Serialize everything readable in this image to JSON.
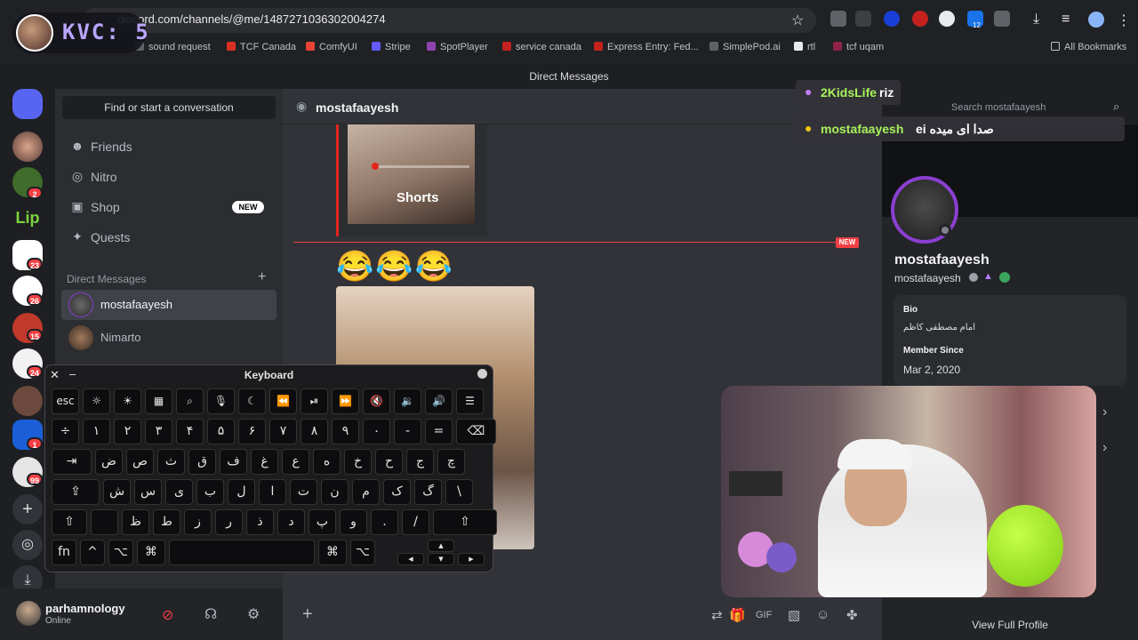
{
  "browser": {
    "url": "discord.com/channels/@me/1487271036302004274",
    "bookmarks": [
      "sound request",
      "TCF Canada",
      "ComfyUI",
      "Stripe",
      "SpotPlayer",
      "service canada",
      "Express Entry: Fed...",
      "SimplePod.ai",
      "rtl",
      "tcf uqam",
      "All Bookmarks"
    ],
    "extension_badge": "12"
  },
  "stream_badge": {
    "text": "KVC: 5"
  },
  "discord": {
    "window_title": "Direct Messages",
    "server_badges": [
      "2",
      "23",
      "26",
      "15",
      "24",
      "1",
      "99"
    ],
    "sidebar": {
      "search_placeholder": "Find or start a conversation",
      "nav": [
        {
          "label": "Friends",
          "icon": "friends-icon"
        },
        {
          "label": "Nitro",
          "icon": "nitro-icon"
        },
        {
          "label": "Shop",
          "icon": "shop-icon",
          "badge": "NEW"
        },
        {
          "label": "Quests",
          "icon": "quests-icon"
        }
      ],
      "dm_header": "Direct Messages",
      "dms": [
        {
          "name": "mostafaayesh",
          "selected": true
        },
        {
          "name": "Nimarto",
          "selected": false
        }
      ]
    },
    "user_panel": {
      "username": "parhamnology",
      "status": "Online"
    },
    "chat": {
      "recipient": "mostafaayesh",
      "shorts_label": "Shorts",
      "new_divider": "NEW",
      "emoji_message": "😂😂😂",
      "search_placeholder": "Search mostafaayesh"
    },
    "profile": {
      "display_name": "mostafaayesh",
      "username": "mostafaayesh",
      "bio_label": "Bio",
      "bio": "امام مصطفی کاظم",
      "member_since_label": "Member Since",
      "member_since": "Mar 2, 2020",
      "view_full": "View Full Profile"
    }
  },
  "stream_chat": [
    {
      "user": "2KidsLife",
      "message": "riz",
      "user_color": "#a7f25a"
    },
    {
      "user": "mostafaayesh",
      "message": "ei صدا ای میده",
      "user_color": "#a7f25a"
    }
  ],
  "keyboard": {
    "title": "Keyboard",
    "rows": [
      [
        "esc",
        "☼",
        "☀",
        "▦",
        "⌕",
        "🎙",
        "☾",
        "⏪",
        "⏯",
        "⏩",
        "🔇",
        "🔉",
        "🔊",
        "☰"
      ],
      [
        "÷",
        "۱",
        "۲",
        "۳",
        "۴",
        "۵",
        "۶",
        "۷",
        "۸",
        "۹",
        "۰",
        "-",
        "=",
        "⌫"
      ],
      [
        "⇥",
        "ض",
        "ص",
        "ث",
        "ق",
        "ف",
        "غ",
        "ع",
        "ه",
        "خ",
        "ح",
        "ج",
        "چ"
      ],
      [
        "⇪",
        "ش",
        "س",
        "ی",
        "ب",
        "ل",
        "ا",
        "ت",
        "ن",
        "م",
        "ک",
        "گ",
        "\\"
      ],
      [
        "⇧",
        "",
        "ظ",
        "ط",
        "ز",
        "ر",
        "ذ",
        "د",
        "پ",
        "و",
        ".",
        "/",
        "⇧"
      ],
      [
        "fn",
        "^",
        "⌥",
        "⌘",
        "",
        "⌘",
        "⌥"
      ]
    ]
  },
  "colors": {
    "discord_bg": "#313338",
    "sidebar": "#2b2d31",
    "accent_red": "#f23f43",
    "keyboard_bg": "#1c1c1e"
  }
}
